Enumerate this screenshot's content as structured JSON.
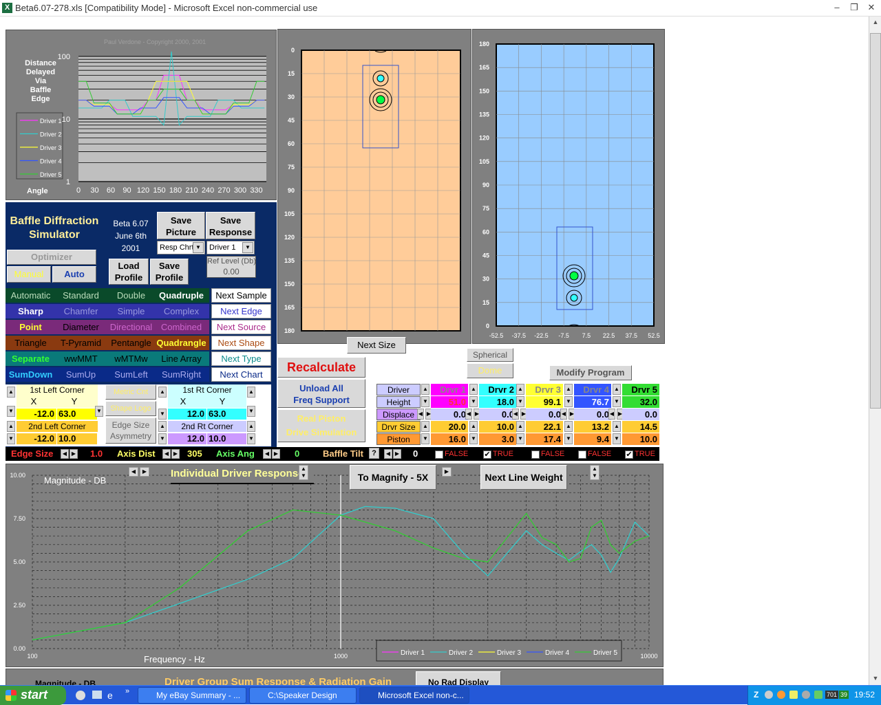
{
  "window": {
    "title": "Beta6.07-278.xls  [Compatibility Mode] - Microsoft Excel non-commercial use"
  },
  "sim": {
    "copyright": "Paul Verdone  -  Copyright  2000, 2001",
    "title": "Baffle Diffraction Simulator",
    "version": "Beta 6.07",
    "date1": "June 6th",
    "date2": "2001"
  },
  "distance_chart": {
    "left_label": [
      "Distance",
      "Delayed",
      "Via",
      "Baffle",
      "Edge"
    ],
    "angle_label": "Angle",
    "y_ticks": [
      "100",
      "10",
      "1"
    ],
    "x_ticks": [
      "0",
      "30",
      "60",
      "90",
      "120",
      "150",
      "180",
      "210",
      "240",
      "270",
      "300",
      "330"
    ],
    "legend": [
      "Driver 1",
      "Driver 2",
      "Driver 3",
      "Driver 4",
      "Driver 5"
    ]
  },
  "baffle_front": {
    "y_ticks": [
      "0",
      "15",
      "30",
      "45",
      "60",
      "75",
      "90",
      "105",
      "120",
      "135",
      "150",
      "165",
      "180"
    ],
    "next_size": "Next Size"
  },
  "baffle_side": {
    "y_ticks": [
      "180",
      "165",
      "150",
      "135",
      "120",
      "105",
      "90",
      "75",
      "60",
      "45",
      "30",
      "15",
      "0"
    ],
    "x_ticks": [
      "-52.5",
      "-37.5",
      "-22.5",
      "-7.5",
      "7.5",
      "22.5",
      "37.5",
      "52.5"
    ]
  },
  "controls": {
    "save_picture": "Save Picture",
    "save_response": "Save Response",
    "resp_chrt": "Resp Chrt",
    "driver1": "Driver 1",
    "optimizer": "Optimizer",
    "manual": "Manual",
    "auto": "Auto",
    "load_profile": "Load Profile",
    "save_profile": "Save Profile",
    "ref_level_label": "Ref Level (Db)",
    "ref_level_value": "0.00"
  },
  "option_rows": [
    {
      "opts": [
        "Automatic",
        "Standard",
        "Double",
        "Quadruple"
      ],
      "next": "Next Sample"
    },
    {
      "opts": [
        "Sharp",
        "Chamfer",
        "Simple",
        "Complex"
      ],
      "next": "Next Edge"
    },
    {
      "opts": [
        "Point",
        "Diameter",
        "Directional",
        "Combined"
      ],
      "next": "Next Source"
    },
    {
      "opts": [
        "Triangle",
        "T-Pyramid",
        "Pentangle",
        "Quadrangle"
      ],
      "next": "Next Shape"
    },
    {
      "opts": [
        "Separate",
        "wwMMT",
        "wMTMw",
        "Line Array"
      ],
      "next": "Next Type"
    },
    {
      "opts": [
        "SumDown",
        "SumUp",
        "SumLeft",
        "SumRight"
      ],
      "next": "Next Chart"
    }
  ],
  "corners": {
    "first_left": "1st Left Corner",
    "x": "X",
    "y": "Y",
    "fl_x": "-12.0",
    "fl_y": "63.0",
    "second_left": "2nd Left Corner",
    "sl_x": "-12.0",
    "sl_y": "10.0",
    "metric_cnt": "Metric Cnt",
    "shape_logo": "Shape Logo",
    "edge_size_asym": "Edge Size Asymmetry",
    "first_rt": "1st Rt Corner",
    "fr_x": "12.0",
    "fr_y": "63.0",
    "second_rt": "2nd Rt Corner",
    "sr_x": "12.0",
    "sr_y": "10.0"
  },
  "recalc": {
    "recalculate": "Recalculate",
    "unload": "Unload All",
    "freq_support": "Freq Support",
    "real_piston": "Real Piston",
    "drive_sim": "Drive Simulation",
    "spherical": "Spherical",
    "dome": "Dome",
    "modify": "Modify Program"
  },
  "driver_table": {
    "labels": [
      "Driver",
      "Height",
      "Displace",
      "Drvr Size",
      "Piston"
    ],
    "drivers": [
      {
        "name": "Drvr 1",
        "height": "51.0",
        "displace": "0.0",
        "size": "20.0",
        "piston": "16.0",
        "color": "#ff00ff"
      },
      {
        "name": "Drvr 2",
        "height": "18.0",
        "displace": "0.0",
        "size": "10.0",
        "piston": "3.0",
        "color": "#33ffff"
      },
      {
        "name": "Drvr 3",
        "height": "99.1",
        "displace": "0.0",
        "size": "22.1",
        "piston": "17.4",
        "color": "#ffff33"
      },
      {
        "name": "Drvr 4",
        "height": "76.7",
        "displace": "0.0",
        "size": "13.2",
        "piston": "9.4",
        "color": "#3355ff"
      },
      {
        "name": "Drvr 5",
        "height": "32.0",
        "displace": "0.0",
        "size": "14.5",
        "piston": "10.0",
        "color": "#33dd33"
      }
    ]
  },
  "status_row": {
    "edge_size_label": "Edge Size",
    "edge_size_value": "1.0",
    "axis_dist_label": "Axis Dist",
    "axis_dist_value": "305",
    "axis_ang_label": "Axis Ang",
    "axis_ang_value": "0",
    "baffle_tilt_label": "Baffle Tilt",
    "baffle_tilt_q": "?",
    "baffle_tilt_value": "0",
    "checks": [
      {
        "label": "FALSE",
        "checked": false
      },
      {
        "label": "TRUE",
        "checked": true
      },
      {
        "label": "FALSE",
        "checked": false
      },
      {
        "label": "FALSE",
        "checked": false
      },
      {
        "label": "TRUE",
        "checked": true
      }
    ]
  },
  "response_chart": {
    "title": "Individual Driver Response",
    "magnify": "To Magnify - 5X",
    "line_weight": "Next Line Weight",
    "ylabel": "Magnitude  -  DB",
    "xlabel": "Frequency  -  Hz",
    "y_ticks": [
      "10.00",
      "7.50",
      "5.00",
      "2.50",
      "0.00"
    ],
    "x_ticks": [
      "100",
      "1000",
      "10000"
    ],
    "legend": [
      "Driver 1",
      "Driver 2",
      "Driver 3",
      "Driver 4",
      "Driver 5"
    ]
  },
  "chart_data": {
    "type": "line",
    "title": "Individual Driver Response",
    "xlabel": "Frequency  -  Hz",
    "ylabel": "Magnitude  -  DB",
    "xscale": "log",
    "xlim": [
      100,
      10000
    ],
    "ylim": [
      0,
      10
    ],
    "series": [
      {
        "name": "Driver 2",
        "color": "#33cccc",
        "x": [
          100,
          200,
          300,
          500,
          700,
          1000,
          1200,
          1500,
          2000,
          2500,
          3000,
          4000,
          4500,
          5000,
          5500,
          6000,
          6500,
          7000,
          7500,
          8000,
          9000,
          10000
        ],
        "y": [
          0.5,
          1.5,
          2.6,
          4.0,
          5.2,
          7.7,
          8.2,
          8.1,
          7.5,
          5.5,
          4.2,
          6.8,
          6.0,
          5.5,
          5.1,
          5.6,
          6.0,
          5.4,
          4.4,
          5.2,
          7.3,
          6.5
        ]
      },
      {
        "name": "Driver 5",
        "color": "#33cc33",
        "x": [
          100,
          200,
          300,
          500,
          700,
          1000,
          1200,
          1500,
          2000,
          2500,
          3000,
          4000,
          4500,
          5000,
          5500,
          6000,
          6500,
          7000,
          7500,
          8000,
          9000,
          10000
        ],
        "y": [
          0.5,
          1.5,
          3.5,
          6.8,
          8.0,
          7.7,
          7.3,
          6.8,
          5.8,
          5.2,
          5.0,
          7.8,
          6.4,
          6.0,
          5.0,
          5.2,
          7.0,
          7.4,
          6.0,
          5.5,
          6.2,
          6.5
        ]
      }
    ]
  },
  "bottom": {
    "magnitude": "Magnitude  -  DB",
    "group_sum": "Driver Group Sum Response  &  Radiation Gain",
    "no_rad": "No Rad Display"
  },
  "taskbar": {
    "start": "start",
    "tasks": [
      "My eBay Summary - ...",
      "C:\\Speaker Design",
      "Microsoft Excel non-c..."
    ],
    "tray_nums": [
      "701",
      "39"
    ],
    "clock": "19:52"
  }
}
